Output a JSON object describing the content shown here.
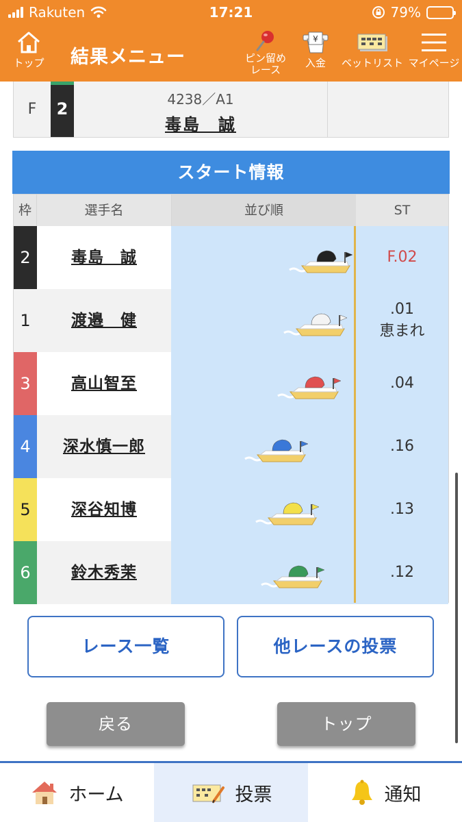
{
  "status_bar": {
    "carrier": "Rakuten",
    "time": "17:21",
    "battery": "79%",
    "battery_level": 0.79
  },
  "header": {
    "home_label": "トップ",
    "title": "結果メニュー",
    "pin_label_1": "ピン留め",
    "pin_label_2": "レース",
    "deposit_label": "入金",
    "bet_list_label": "ベットリスト",
    "mypage_label": "マイページ"
  },
  "race_row": {
    "result": "F",
    "waku": "2",
    "reg": "4238／A1",
    "name": "毒島　誠"
  },
  "start_info": {
    "title": "スタート情報",
    "headers": {
      "waku": "枠",
      "name": "選手名",
      "order": "並び順",
      "st": "ST"
    },
    "rows": [
      {
        "waku": "2",
        "name": "毒島　誠",
        "st": "F.02",
        "note": "",
        "color": "#2b2b2b",
        "text_color": "#ffffff",
        "boat_color": "#222222",
        "flag_color": "#222222",
        "position": 0.98
      },
      {
        "waku": "1",
        "name": "渡邉　健",
        "st": ".01",
        "note": "恵まれ",
        "color": "#f2f2f2",
        "text_color": "#222222",
        "boat_color": "#f4f4f4",
        "flag_color": "#f4f4f4",
        "position": 0.95
      },
      {
        "waku": "3",
        "name": "高山智至",
        "st": ".04",
        "note": "",
        "color": "#e06666",
        "text_color": "#ffffff",
        "boat_color": "#e05050",
        "flag_color": "#e05050",
        "position": 0.92
      },
      {
        "waku": "4",
        "name": "深水慎一郎",
        "st": ".16",
        "note": "",
        "color": "#4a86e0",
        "text_color": "#ffffff",
        "boat_color": "#3a78d8",
        "flag_color": "#3a78d8",
        "position": 0.74
      },
      {
        "waku": "5",
        "name": "深谷知博",
        "st": ".13",
        "note": "",
        "color": "#f5e15a",
        "text_color": "#222222",
        "boat_color": "#f3e04a",
        "flag_color": "#f3e04a",
        "position": 0.8
      },
      {
        "waku": "6",
        "name": "鈴木秀茉",
        "st": ".12",
        "note": "",
        "color": "#4aa86a",
        "text_color": "#ffffff",
        "boat_color": "#3a9a5a",
        "flag_color": "#3a9a5a",
        "position": 0.83
      }
    ]
  },
  "buttons": {
    "race_list": "レース一覧",
    "other_race_vote": "他レースの投票",
    "back": "戻る",
    "top": "トップ"
  },
  "bottom_nav": {
    "home": "ホーム",
    "vote": "投票",
    "notify": "通知"
  }
}
